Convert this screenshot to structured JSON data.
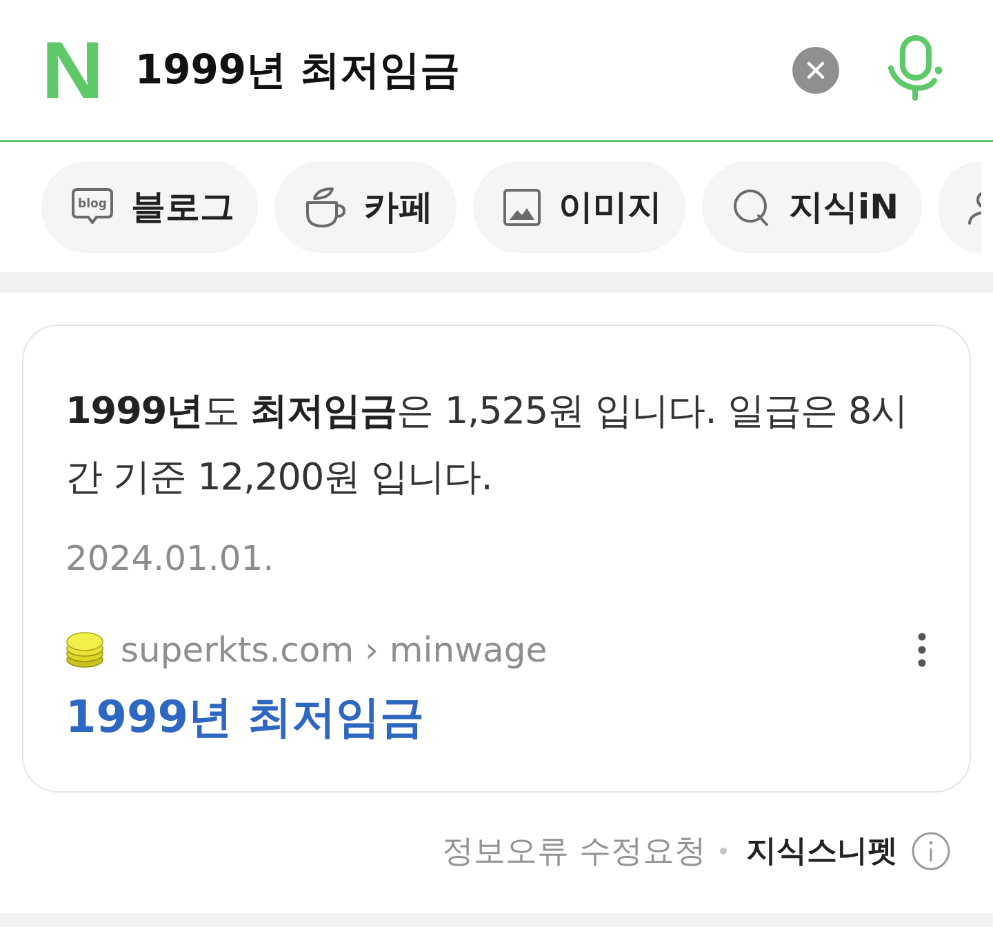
{
  "search": {
    "logo": "N",
    "query": "1999년 최저임금"
  },
  "tabs": [
    {
      "kind": "blog",
      "icon_text": "blog",
      "label": "블로그",
      "selected": false
    },
    {
      "kind": "cafe",
      "label": "카페",
      "selected": false
    },
    {
      "kind": "image",
      "label": "이미지",
      "selected": false
    },
    {
      "kind": "kin",
      "label": "지식iN",
      "selected": false
    },
    {
      "kind": "person",
      "selected": false
    }
  ],
  "snippet": {
    "answer": "**1999년**도 **최저임금**은 1,525원 입니다. 일급은 8시간 기준 12,200원 입니다.",
    "date": "2024.01.01.",
    "source": "superkts.com › minwage",
    "title": "1999년 최저임금"
  },
  "footer": {
    "report": "정보오류 수정요청",
    "brand": "지식스니펫"
  }
}
